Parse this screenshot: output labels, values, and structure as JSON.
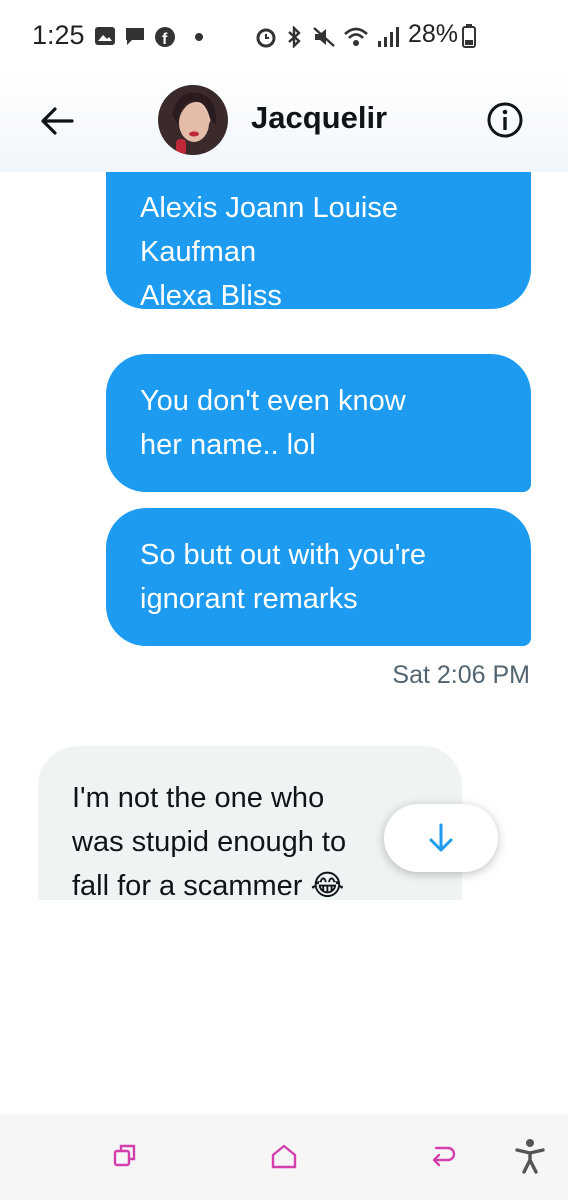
{
  "status_bar": {
    "time": "1:25",
    "battery": "28%"
  },
  "header": {
    "title": "Jacquelir"
  },
  "messages": [
    {
      "direction": "out",
      "text": "Alexis Joann Louise\nKaufman\nAlexa Bliss"
    },
    {
      "direction": "out",
      "text": "You don't even know\nher name.. lol"
    },
    {
      "direction": "out",
      "text": "So butt out with you're\nignorant remarks"
    },
    {
      "direction": "in",
      "text": "I'm not the one who\nwas stupid enough to\nfall for a scammer 😂"
    }
  ],
  "timestamp": "Sat 2:06 PM",
  "colors": {
    "accent": "#1d9bf0",
    "incoming_bubble": "#eff3f4",
    "nav_icon": "#d43fae"
  },
  "icons": {
    "back": "arrow-left-icon",
    "info": "info-circle-icon",
    "scroll_down": "arrow-down-icon",
    "nav_recents": "recents-icon",
    "nav_home": "home-icon",
    "nav_back": "back-icon",
    "accessibility": "accessibility-icon"
  }
}
